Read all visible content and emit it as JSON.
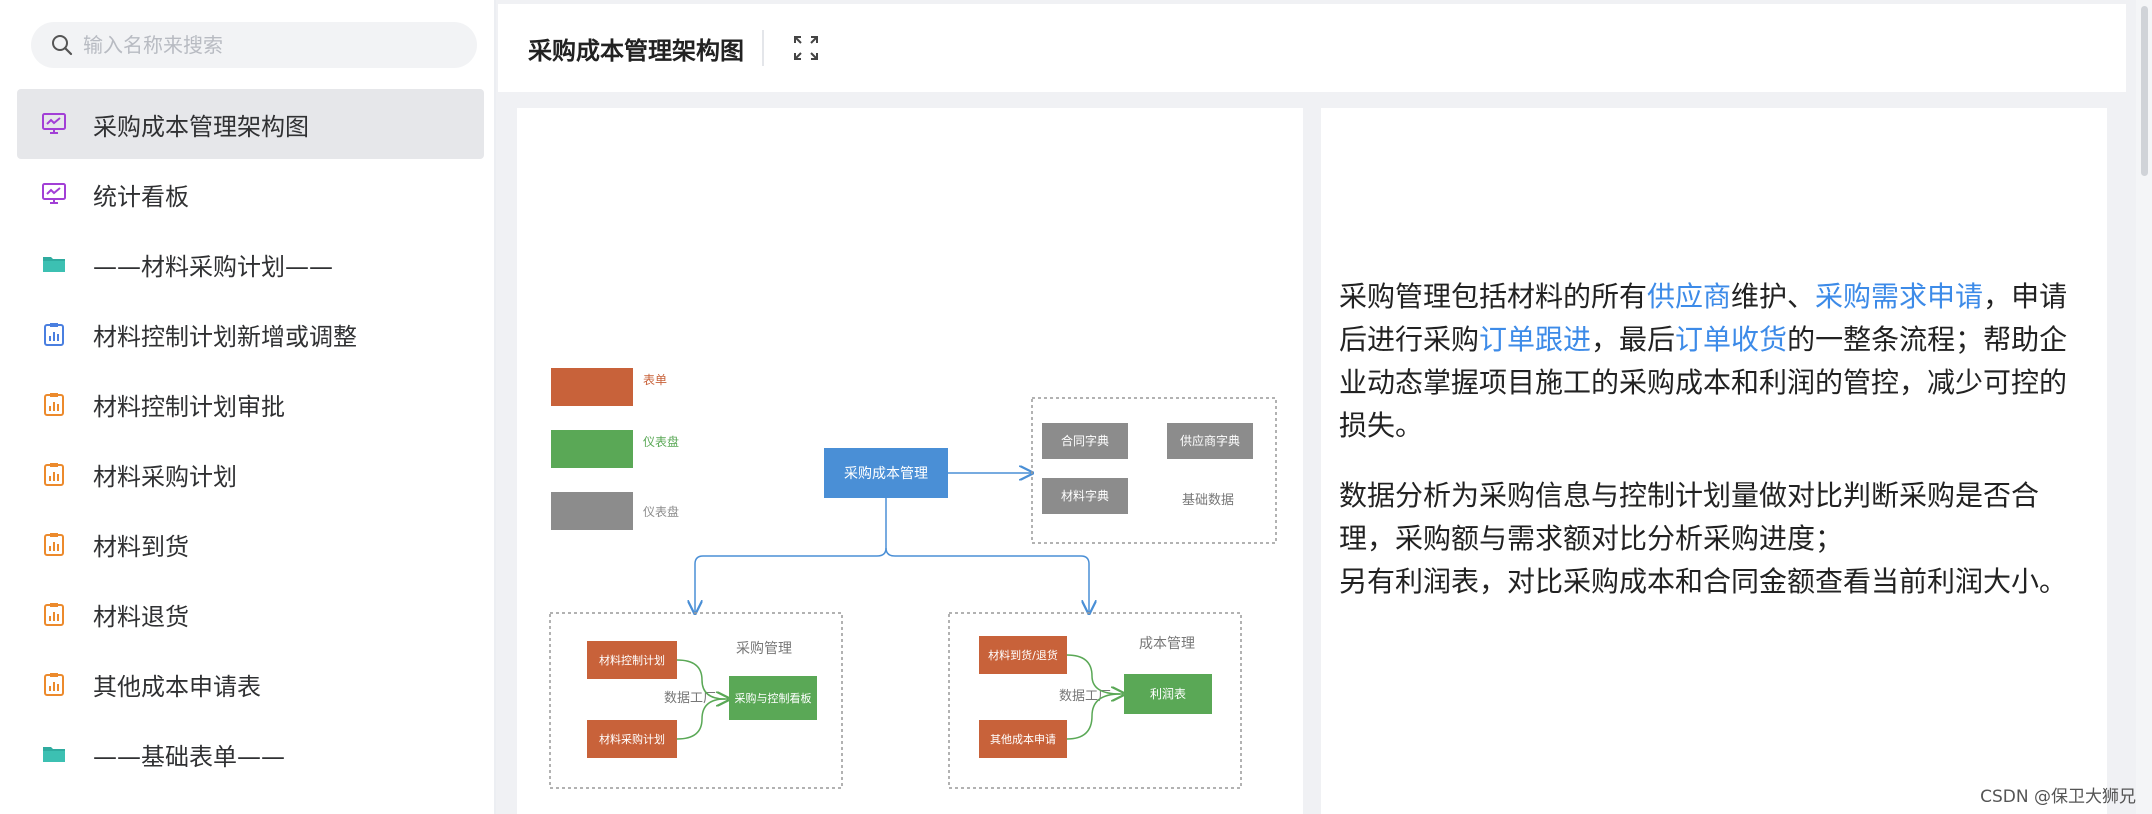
{
  "search": {
    "placeholder": "输入名称来搜索"
  },
  "sidebar": {
    "items": [
      {
        "label": "采购成本管理架构图",
        "icon": "dashboard-monitor-icon",
        "active": true
      },
      {
        "label": "统计看板",
        "icon": "dashboard-monitor-icon"
      },
      {
        "label": "——材料采购计划——",
        "icon": "folder-icon"
      },
      {
        "label": "材料控制计划新增或调整",
        "icon": "form-clipboard-icon"
      },
      {
        "label": "材料控制计划审批",
        "icon": "form-clipboard-icon"
      },
      {
        "label": "材料采购计划",
        "icon": "form-clipboard-icon"
      },
      {
        "label": "材料到货",
        "icon": "form-clipboard-icon"
      },
      {
        "label": "材料退货",
        "icon": "form-clipboard-icon"
      },
      {
        "label": "其他成本申请表",
        "icon": "form-clipboard-icon"
      },
      {
        "label": "——基础表单——",
        "icon": "folder-icon"
      }
    ]
  },
  "header": {
    "title": "采购成本管理架构图",
    "expand_icon": "fullscreen-icon"
  },
  "diagram": {
    "legend": [
      {
        "label": "表单",
        "color": "#c8623a"
      },
      {
        "label": "仪表盘",
        "color": "#5aa856"
      },
      {
        "label": "仪表盘",
        "color": "#8c8c8c"
      }
    ],
    "center": "采购成本管理",
    "base_box": {
      "items": [
        "合同字典",
        "供应商字典",
        "材料字典"
      ],
      "label": "基础数据"
    },
    "purchase_box": {
      "title": "采购管理",
      "forms": [
        "材料控制计划",
        "材料采购计划"
      ],
      "factory": "数据工厂",
      "board": "采购与控制看板"
    },
    "cost_box": {
      "title": "成本管理",
      "forms": [
        "材料到货/退货",
        "其他成本申请"
      ],
      "factory": "数据工厂",
      "board": "利润表"
    }
  },
  "description": {
    "p1": [
      {
        "t": "采购管理包括材料的所有"
      },
      {
        "t": "供应商",
        "hl": true
      },
      {
        "t": "维护、"
      },
      {
        "t": "采购需求申请",
        "hl": true
      },
      {
        "t": "，申请后进行采购"
      },
      {
        "t": "订单跟进",
        "hl": true
      },
      {
        "t": "，最后"
      },
      {
        "t": "订单收货",
        "hl": true
      },
      {
        "t": "的一整条流程；帮助企业动态掌握项目施工的采购成本和利润的管控，减少可控的损失。"
      }
    ],
    "p2_line1": "数据分析为采购信息与控制计划量做对比判断采购是否合理，采购额与需求额对比分析采购进度；",
    "p2_line2": "另有利润表，对比采购成本和合同金额查看当前利润大小。"
  },
  "colors": {
    "accent": "#3d8be8",
    "form": "#c8623a",
    "board": "#5aa856",
    "dict": "#8c8c8c",
    "center": "#4a8fd6"
  },
  "watermark": "CSDN @保卫大狮兄"
}
